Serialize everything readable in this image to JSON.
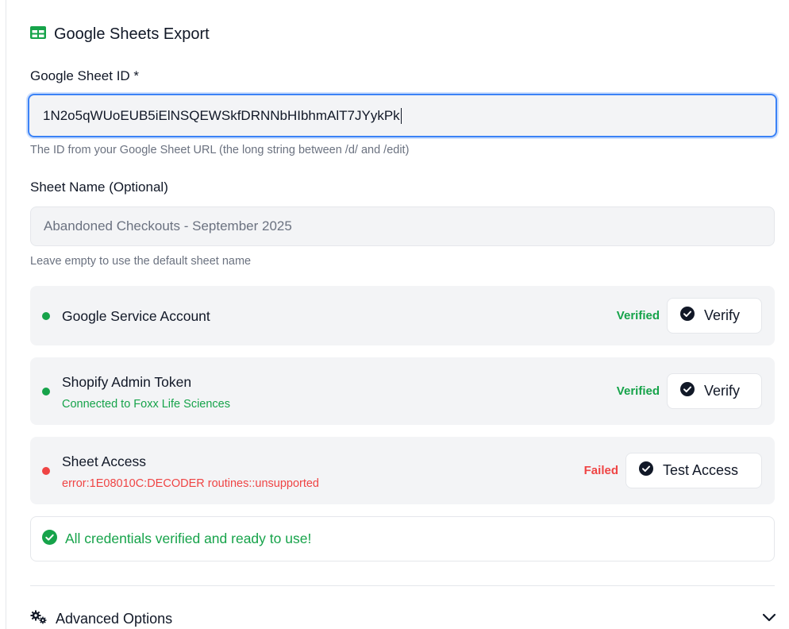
{
  "header": {
    "title": "Google Sheets Export",
    "icon": "sheets-table-icon",
    "icon_color": "#16a34a"
  },
  "sheet_id": {
    "label": "Google Sheet ID *",
    "value": "1N2o5qWUoEUB5iElNSQEWSkfDRNNbHIbhmAlT7JYykPk",
    "hint": "The ID from your Google Sheet URL (the long string between /d/ and /edit)"
  },
  "sheet_name": {
    "label": "Sheet Name (Optional)",
    "placeholder": "Abandoned Checkouts - September 2025",
    "hint": "Leave empty to use the default sheet name"
  },
  "credentials": [
    {
      "title": "Google Service Account",
      "subtitle": "",
      "status": "Verified",
      "button": "Verify",
      "state": "ok"
    },
    {
      "title": "Shopify Admin Token",
      "subtitle": "Connected to Foxx Life Sciences",
      "status": "Verified",
      "button": "Verify",
      "state": "ok"
    },
    {
      "title": "Sheet Access",
      "subtitle": "error:1E08010C:DECODER routines::unsupported",
      "status": "Failed",
      "button": "Test Access",
      "state": "failed"
    }
  ],
  "success_message": "All credentials verified and ready to use!",
  "advanced": {
    "label": "Advanced Options"
  },
  "colors": {
    "accent": "#3b82f6",
    "success": "#16a34a",
    "error": "#ef4444"
  }
}
